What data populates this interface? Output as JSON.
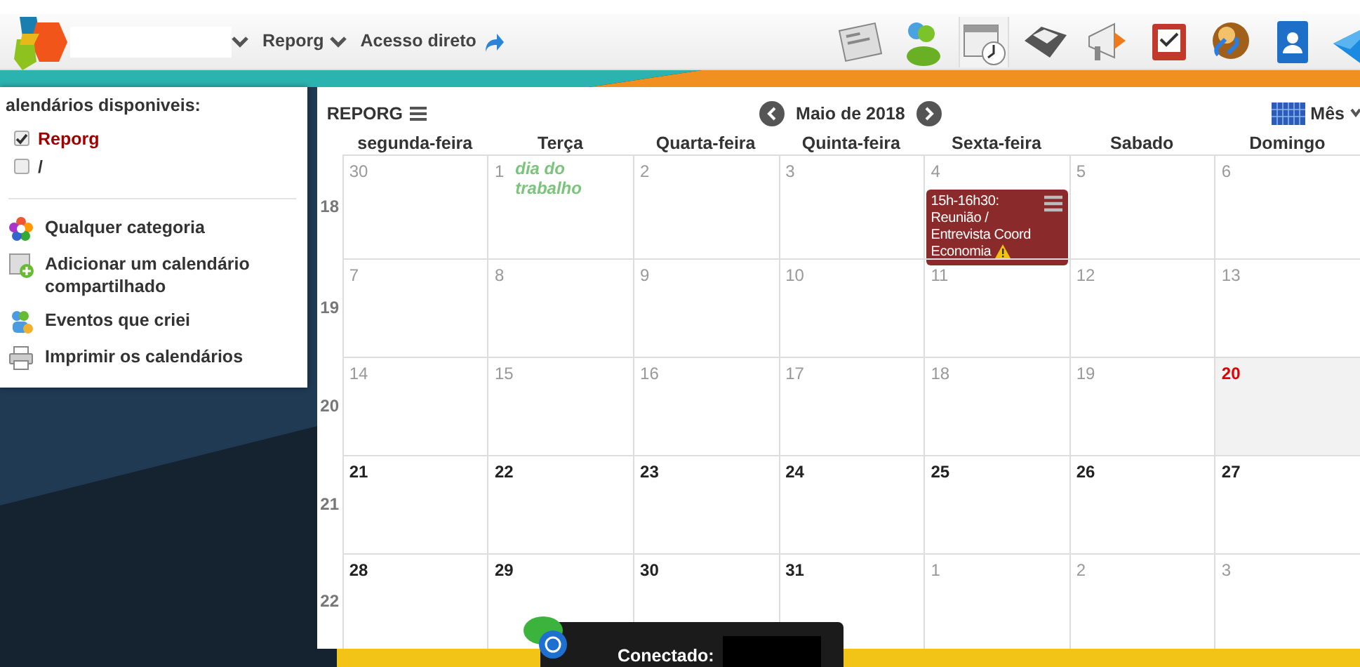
{
  "toolbar": {
    "menus": [
      {
        "label": "Reporg"
      }
    ],
    "shortcut": "Acesso direto",
    "apps": [
      {
        "kind": "news",
        "selected": false
      },
      {
        "kind": "users",
        "selected": false
      },
      {
        "kind": "calendar",
        "selected": true
      },
      {
        "kind": "folder",
        "selected": false
      },
      {
        "kind": "megaphone",
        "selected": false
      },
      {
        "kind": "tasks",
        "selected": false
      },
      {
        "kind": "links",
        "selected": false
      },
      {
        "kind": "contacts",
        "selected": false
      },
      {
        "kind": "mail",
        "selected": false
      }
    ]
  },
  "sidebar": {
    "title": "alendários disponiveis:",
    "calendars": [
      {
        "label": "Reporg",
        "checked": true,
        "color": "#a00000"
      },
      {
        "label": "/",
        "checked": false,
        "color": "#333333"
      }
    ],
    "actions": [
      {
        "kind": "category",
        "label": "Qualquer categoria"
      },
      {
        "kind": "add",
        "label": "Adicionar um calendário compartilhado"
      },
      {
        "kind": "mine",
        "label": "Eventos que criei"
      },
      {
        "kind": "print",
        "label": "Imprimir os calendários"
      }
    ]
  },
  "calendar": {
    "title": "REPORG",
    "month": "Maio de 2018",
    "view": "Mês",
    "weekdays": [
      "segunda-feira",
      "Terça",
      "Quarta-feira",
      "Quinta-feira",
      "Sexta-feira",
      "Sabado",
      "Domingo"
    ],
    "weeks": [
      {
        "number": "18",
        "days": [
          {
            "day": "30",
            "kind": "outside"
          },
          {
            "day": "1",
            "kind": "past",
            "holiday": "dia do trabalho"
          },
          {
            "day": "2",
            "kind": "past"
          },
          {
            "day": "3",
            "kind": "past"
          },
          {
            "day": "4",
            "kind": "past",
            "events": [
              {
                "title": "15h-16h30: Reunião / Entrevista Coord Economia",
                "warning": true
              }
            ]
          },
          {
            "day": "5",
            "kind": "past"
          },
          {
            "day": "6",
            "kind": "past"
          }
        ]
      },
      {
        "number": "19",
        "days": [
          {
            "day": "7",
            "kind": "past"
          },
          {
            "day": "8",
            "kind": "past"
          },
          {
            "day": "9",
            "kind": "past"
          },
          {
            "day": "10",
            "kind": "past"
          },
          {
            "day": "11",
            "kind": "past"
          },
          {
            "day": "12",
            "kind": "past"
          },
          {
            "day": "13",
            "kind": "past"
          }
        ]
      },
      {
        "number": "20",
        "days": [
          {
            "day": "14",
            "kind": "past"
          },
          {
            "day": "15",
            "kind": "past"
          },
          {
            "day": "16",
            "kind": "past"
          },
          {
            "day": "17",
            "kind": "past"
          },
          {
            "day": "18",
            "kind": "past"
          },
          {
            "day": "19",
            "kind": "past"
          },
          {
            "day": "20",
            "kind": "today"
          }
        ]
      },
      {
        "number": "21",
        "days": [
          {
            "day": "21",
            "kind": "upcoming"
          },
          {
            "day": "22",
            "kind": "upcoming"
          },
          {
            "day": "23",
            "kind": "upcoming"
          },
          {
            "day": "24",
            "kind": "upcoming"
          },
          {
            "day": "25",
            "kind": "upcoming"
          },
          {
            "day": "26",
            "kind": "upcoming"
          },
          {
            "day": "27",
            "kind": "upcoming"
          }
        ]
      },
      {
        "number": "22",
        "days": [
          {
            "day": "28",
            "kind": "upcoming"
          },
          {
            "day": "29",
            "kind": "upcoming"
          },
          {
            "day": "30",
            "kind": "upcoming"
          },
          {
            "day": "31",
            "kind": "upcoming"
          },
          {
            "day": "1",
            "kind": "outside"
          },
          {
            "day": "2",
            "kind": "outside"
          },
          {
            "day": "3",
            "kind": "outside"
          }
        ]
      }
    ]
  },
  "chat": {
    "status": "Conectado:"
  }
}
